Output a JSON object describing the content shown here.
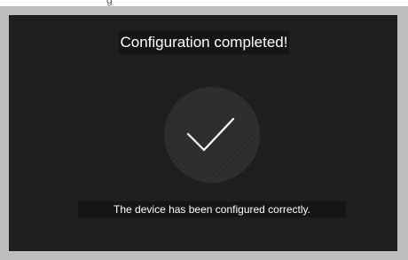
{
  "dialog": {
    "title": "Configuration completed!",
    "message": "The device has been configured correctly.",
    "icon": "checkmark-icon"
  },
  "top_strip": {
    "partial_text": "g"
  },
  "colors": {
    "frame": "#bdbdbd",
    "screen_background": "#1d1f21",
    "label_background": "#141516",
    "text": "#ffffff",
    "circle": "#2c2e30",
    "checkmark": "#ffffff"
  }
}
